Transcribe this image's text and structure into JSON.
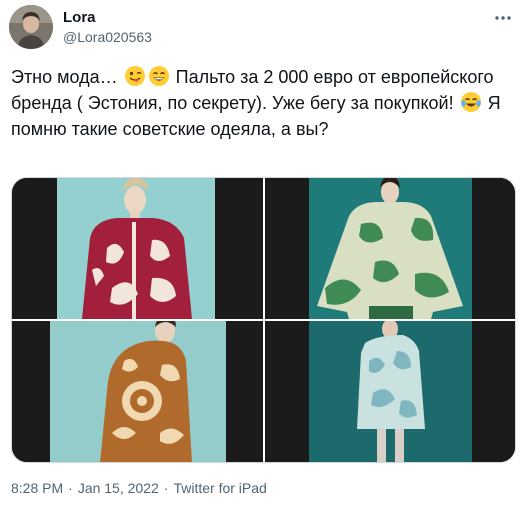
{
  "author": {
    "display_name": "Lora",
    "handle": "@Lora020563"
  },
  "tweet": {
    "text_part1": "Этно мода… ",
    "text_part2": " Пальто за 2 000 евро от европейского бренда ( Эстония, по секрету). Уже бегу за покупкой! ",
    "text_part3": " Я помню такие советские одеяла, а вы?",
    "emojis": [
      "winking-face-with-tongue",
      "grinning-face-with-smiling-eyes",
      "face-with-tears-of-joy"
    ]
  },
  "media": {
    "count": 4,
    "images": [
      {
        "icon": "model-red-blanket-jacket",
        "background": "#93d0cf"
      },
      {
        "icon": "model-green-floral-coat",
        "background": "#1f7a7a"
      },
      {
        "icon": "model-brown-ornament-coat",
        "background": "#94cccc"
      },
      {
        "icon": "model-pale-blue-coat",
        "background": "#1d6a6c"
      }
    ]
  },
  "meta": {
    "time": "8:28 PM",
    "date": "Jan 15, 2022",
    "source": "Twitter for iPad",
    "separator": "·"
  },
  "colors": {
    "text": "#0f1419",
    "secondary": "#536471",
    "border": "#cfd9de"
  }
}
